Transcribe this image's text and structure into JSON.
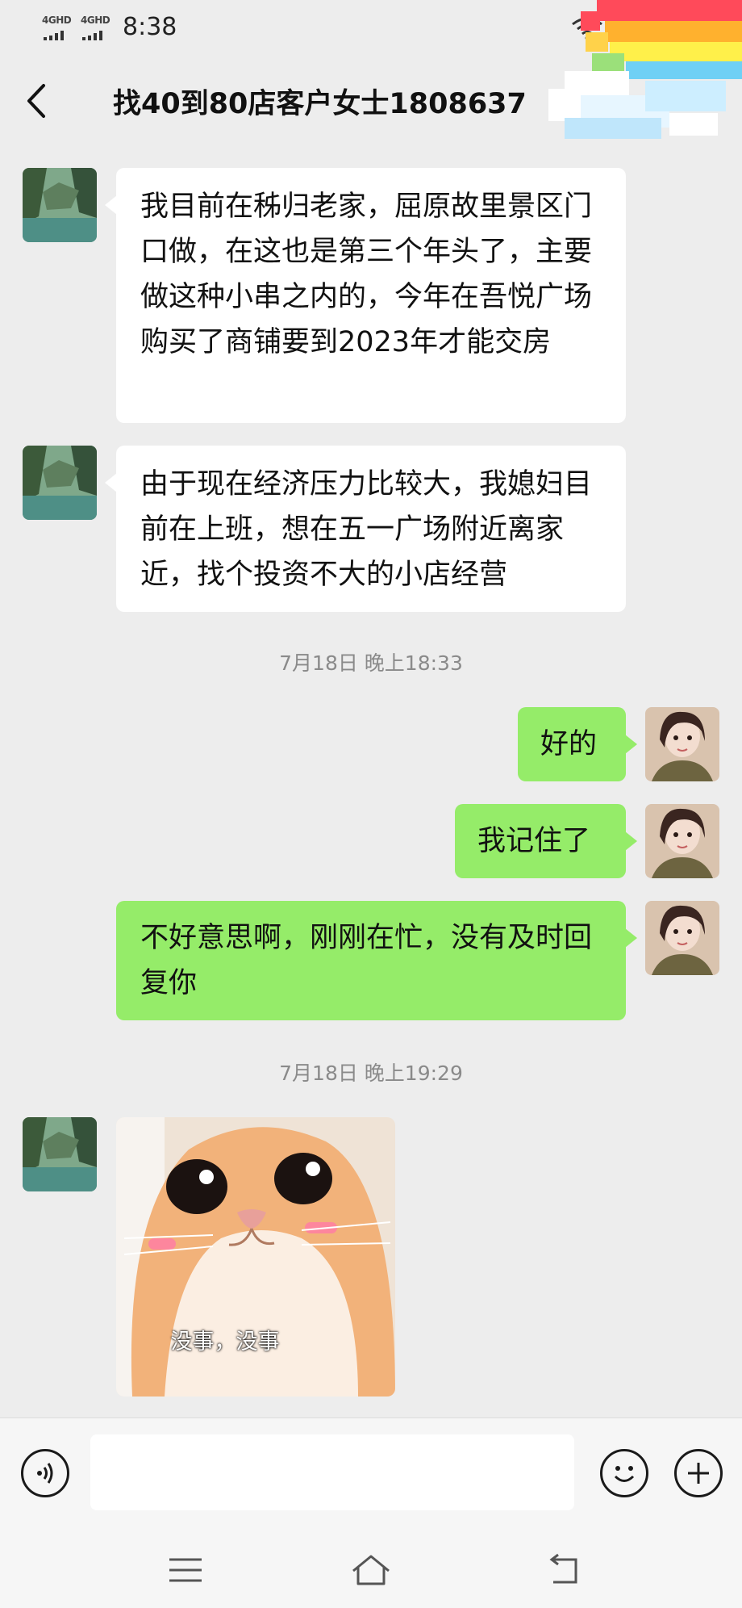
{
  "status_bar": {
    "signal_1": "4GHD",
    "signal_2": "4GHD",
    "time": "8:38"
  },
  "header": {
    "title": "找40到80店客户女士1808637",
    "back_icon": "chevron-left-icon",
    "more_icon": "ellipsis-icon"
  },
  "messages": [
    {
      "side": "in",
      "type": "text",
      "text": "我目前在秭归老家，屈原故里景区门口做，在这也是第三个年头了，主要做这种小串之内的，今年在吾悦广场购买了商铺要到2023年才能交房"
    },
    {
      "side": "in",
      "type": "text",
      "text": "由于现在经济压力比较大，我媳妇目前在上班，想在五一广场附近离家近，找个投资不大的小店经营"
    },
    {
      "type": "timestamp",
      "text": "7月18日 晚上18:33"
    },
    {
      "side": "out",
      "type": "text",
      "text": "好的"
    },
    {
      "side": "out",
      "type": "text",
      "text": "我记住了"
    },
    {
      "side": "out",
      "type": "text",
      "text": "不好意思啊，刚刚在忙，没有及时回复你"
    },
    {
      "type": "timestamp",
      "text": "7月18日 晚上19:29"
    },
    {
      "side": "in",
      "type": "sticker",
      "caption": "没事，没事"
    }
  ],
  "input_bar": {
    "voice_icon": "voice-icon",
    "emoji_icon": "emoji-icon",
    "plus_icon": "plus-icon",
    "placeholder": ""
  },
  "system_nav": {
    "menu_icon": "menu-icon",
    "home_icon": "home-icon",
    "back_icon": "back-icon"
  },
  "colors": {
    "background": "#ededed",
    "incoming_bubble": "#ffffff",
    "outgoing_bubble": "#95ec69",
    "timestamp": "#8a8a8a"
  }
}
